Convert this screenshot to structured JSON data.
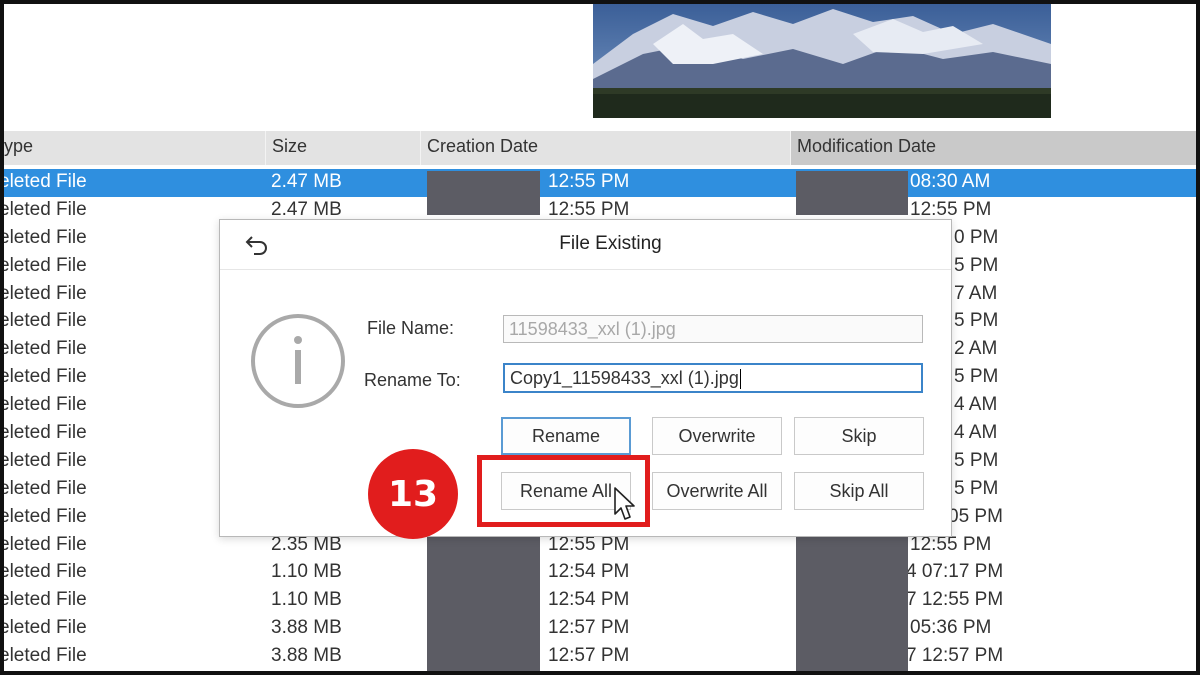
{
  "table": {
    "columns": [
      "ype",
      "Size",
      "Creation Date",
      "Modification Date"
    ],
    "rows": [
      {
        "type": "eleted File",
        "size": "2.47 MB",
        "ctime": "12:55 PM",
        "mtime": "08:30 AM",
        "selected": true
      },
      {
        "type": "eleted File",
        "size": "2.47 MB",
        "ctime": "12:55 PM",
        "mtime": "12:55 PM"
      },
      {
        "type": "eleted File",
        "size": "",
        "ctime": "",
        "mtime": "0 PM"
      },
      {
        "type": "eleted File",
        "size": "",
        "ctime": "",
        "mtime": "5 PM"
      },
      {
        "type": "eleted File",
        "size": "",
        "ctime": "",
        "mtime": "7 AM"
      },
      {
        "type": "eleted File",
        "size": "",
        "ctime": "",
        "mtime": "5 PM"
      },
      {
        "type": "eleted File",
        "size": "",
        "ctime": "",
        "mtime": "2 AM"
      },
      {
        "type": "eleted File",
        "size": "",
        "ctime": "",
        "mtime": "5 PM"
      },
      {
        "type": "eleted File",
        "size": "",
        "ctime": "",
        "mtime": "4 AM"
      },
      {
        "type": "eleted File",
        "size": "",
        "ctime": "",
        "mtime": "4 AM"
      },
      {
        "type": "eleted File",
        "size": "",
        "ctime": "",
        "mtime": "5 PM"
      },
      {
        "type": "eleted File",
        "size": "",
        "ctime": "",
        "mtime": "5 PM"
      },
      {
        "type": "eleted File",
        "size": "",
        "ctime": "",
        "mtime": "05 PM"
      },
      {
        "type": "eleted File",
        "size": "2.35 MB",
        "ctime": "12:55 PM",
        "mtime": "12:55 PM"
      },
      {
        "type": "eleted File",
        "size": "1.10 MB",
        "ctime": "12:54 PM",
        "mtime": "4 07:17 PM"
      },
      {
        "type": "eleted File",
        "size": "1.10 MB",
        "ctime": "12:54 PM",
        "mtime": "7 12:55 PM"
      },
      {
        "type": "eleted File",
        "size": "3.88 MB",
        "ctime": "12:57 PM",
        "mtime": "05:36 PM"
      },
      {
        "type": "eleted File",
        "size": "3.88 MB",
        "ctime": "12:57 PM",
        "mtime": "7 12:57 PM"
      }
    ]
  },
  "dialog": {
    "title": "File Existing",
    "file_name_label": "File Name:",
    "file_name_value": "11598433_xxl (1).jpg",
    "rename_to_label": "Rename To:",
    "rename_to_value": "Copy1_11598433_xxl (1).jpg",
    "buttons": {
      "rename": "Rename",
      "overwrite": "Overwrite",
      "skip": "Skip",
      "rename_all": "Rename All",
      "overwrite_all": "Overwrite All",
      "skip_all": "Skip All"
    }
  },
  "annotation": {
    "step_number": "13",
    "highlight_color": "#e11d1d"
  },
  "colors": {
    "selection": "#2f8fdf",
    "header_bg": "#e3e3e3",
    "redaction": "#5c5c64"
  }
}
